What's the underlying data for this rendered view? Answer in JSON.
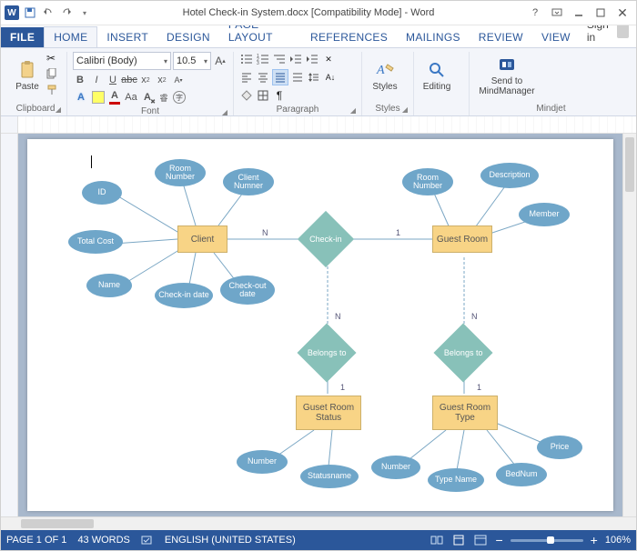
{
  "title": "Hotel Check-in System.docx [Compatibility Mode] - Word",
  "signin": "Sign in",
  "tabs": [
    "FILE",
    "HOME",
    "INSERT",
    "DESIGN",
    "PAGE LAYOUT",
    "REFERENCES",
    "MAILINGS",
    "REVIEW",
    "VIEW"
  ],
  "active_tab": 1,
  "font": {
    "family": "Calibri (Body)",
    "size": "10.5"
  },
  "groups": {
    "clipboard": "Clipboard",
    "font": "Font",
    "paragraph": "Paragraph",
    "styles": "Styles",
    "editing": "Editing",
    "mindjet": "Mindjet"
  },
  "big_buttons": {
    "paste": "Paste",
    "styles": "Styles",
    "editing": "Editing",
    "mindmanager": "Send to MindManager"
  },
  "status": {
    "page": "PAGE 1 OF 1",
    "words": "43 WORDS",
    "lang": "ENGLISH (UNITED STATES)",
    "zoom": "106%"
  },
  "er": {
    "entities": {
      "client": "Client",
      "guest_room": "Guest Room",
      "guest_room_status": "Guset Room Status",
      "guest_room_type": "Guest Room Type"
    },
    "relations": {
      "check_in": "Check-in",
      "belongs_to_status": "Belongs to",
      "belongs_to_type": "Belongs to"
    },
    "attrs": {
      "id": "ID",
      "room_number": "Room Number",
      "client_number": "Client Numner",
      "total_cost": "Total Cost",
      "name": "Name",
      "checkin_date": "Check-in date",
      "checkout_date": "Check-out date",
      "room_number2": "Room Number",
      "description": "Description",
      "member": "Member",
      "status_number": "Number",
      "status_name": "Statusname",
      "type_number": "Number",
      "type_name": "Type Name",
      "bed_num": "BedNum",
      "price": "Price"
    },
    "card": {
      "n": "N",
      "one": "1"
    }
  }
}
